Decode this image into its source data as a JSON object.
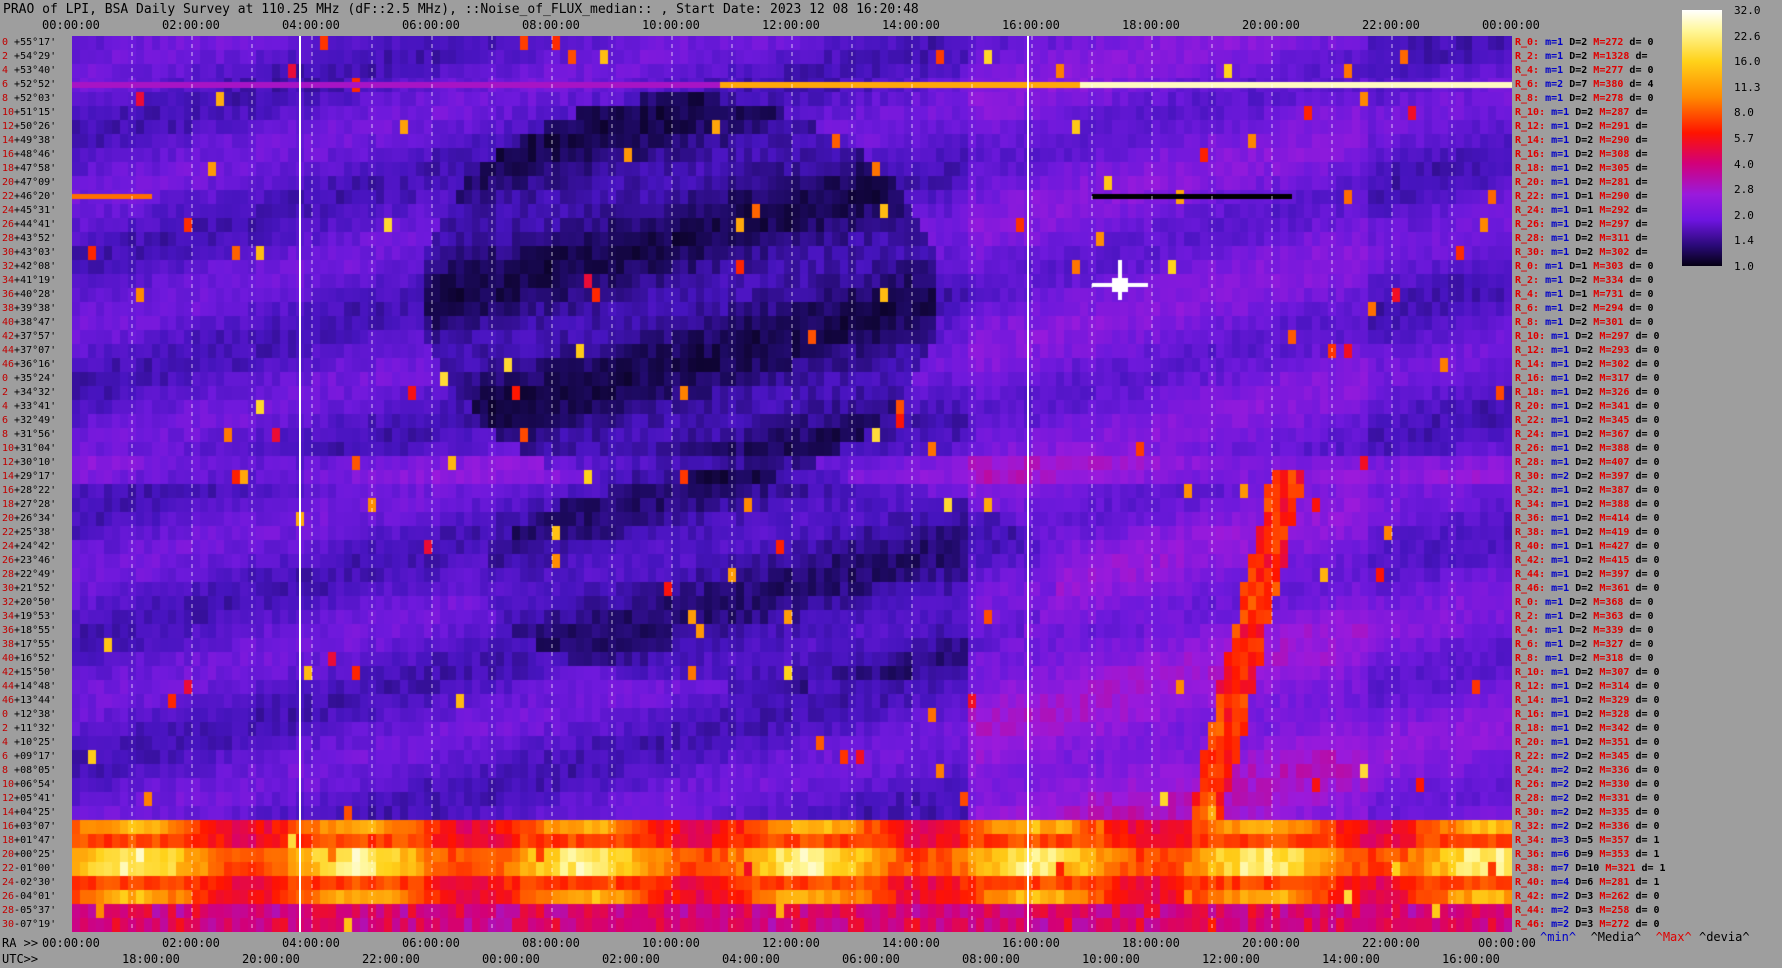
{
  "title": "PRAO of LPI, BSA Daily Survey at 110.25 MHz (dF::2.5 MHz), ::Noise_of_FLUX_median:: , Start Date: 2023 12 08 16:20:48",
  "top_axis_labels": [
    "00:00:00",
    "02:00:00",
    "04:00:00",
    "06:00:00",
    "08:00:00",
    "10:00:00",
    "12:00:00",
    "14:00:00",
    "16:00:00",
    "18:00:00",
    "20:00:00",
    "22:00:00",
    "00:00:00"
  ],
  "ra_axis": {
    "prefix": "RA >>",
    "labels": [
      "00:00:00",
      "02:00:00",
      "04:00:00",
      "06:00:00",
      "08:00:00",
      "10:00:00",
      "12:00:00",
      "14:00:00",
      "16:00:00",
      "18:00:00",
      "20:00:00",
      "22:00:00",
      "00:00:00"
    ]
  },
  "utc_axis": {
    "prefix": "UTC>>",
    "labels": [
      "18:00:00",
      "20:00:00",
      "22:00:00",
      "00:00:00",
      "02:00:00",
      "04:00:00",
      "06:00:00",
      "08:00:00",
      "10:00:00",
      "12:00:00",
      "14:00:00",
      "16:00:00"
    ]
  },
  "beams": [
    {
      "idx": "0",
      "dec": "+55°17'"
    },
    {
      "idx": "2",
      "dec": "+54°29'"
    },
    {
      "idx": "4",
      "dec": "+53°40'"
    },
    {
      "idx": "6",
      "dec": "+52°52'"
    },
    {
      "idx": "8",
      "dec": "+52°03'"
    },
    {
      "idx": "10",
      "dec": "+51°15'"
    },
    {
      "idx": "12",
      "dec": "+50°26'"
    },
    {
      "idx": "14",
      "dec": "+49°38'"
    },
    {
      "idx": "16",
      "dec": "+48°46'"
    },
    {
      "idx": "18",
      "dec": "+47°58'"
    },
    {
      "idx": "20",
      "dec": "+47°09'"
    },
    {
      "idx": "22",
      "dec": "+46°20'"
    },
    {
      "idx": "24",
      "dec": "+45°31'"
    },
    {
      "idx": "26",
      "dec": "+44°41'"
    },
    {
      "idx": "28",
      "dec": "+43°52'"
    },
    {
      "idx": "30",
      "dec": "+43°03'"
    },
    {
      "idx": "32",
      "dec": "+42°08'"
    },
    {
      "idx": "34",
      "dec": "+41°19'"
    },
    {
      "idx": "36",
      "dec": "+40°28'"
    },
    {
      "idx": "38",
      "dec": "+39°38'"
    },
    {
      "idx": "40",
      "dec": "+38°47'"
    },
    {
      "idx": "42",
      "dec": "+37°57'"
    },
    {
      "idx": "44",
      "dec": "+37°07'"
    },
    {
      "idx": "46",
      "dec": "+36°16'"
    },
    {
      "idx": "0",
      "dec": "+35°24'"
    },
    {
      "idx": "2",
      "dec": "+34°32'"
    },
    {
      "idx": "4",
      "dec": "+33°41'"
    },
    {
      "idx": "6",
      "dec": "+32°49'"
    },
    {
      "idx": "8",
      "dec": "+31°56'"
    },
    {
      "idx": "10",
      "dec": "+31°04'"
    },
    {
      "idx": "12",
      "dec": "+30°10'"
    },
    {
      "idx": "14",
      "dec": "+29°17'"
    },
    {
      "idx": "16",
      "dec": "+28°22'"
    },
    {
      "idx": "18",
      "dec": "+27°28'"
    },
    {
      "idx": "20",
      "dec": "+26°34'"
    },
    {
      "idx": "22",
      "dec": "+25°38'"
    },
    {
      "idx": "24",
      "dec": "+24°42'"
    },
    {
      "idx": "26",
      "dec": "+23°46'"
    },
    {
      "idx": "28",
      "dec": "+22°49'"
    },
    {
      "idx": "30",
      "dec": "+21°52'"
    },
    {
      "idx": "32",
      "dec": "+20°50'"
    },
    {
      "idx": "34",
      "dec": "+19°53'"
    },
    {
      "idx": "36",
      "dec": "+18°55'"
    },
    {
      "idx": "38",
      "dec": "+17°55'"
    },
    {
      "idx": "40",
      "dec": "+16°52'"
    },
    {
      "idx": "42",
      "dec": "+15°50'"
    },
    {
      "idx": "44",
      "dec": "+14°48'"
    },
    {
      "idx": "46",
      "dec": "+13°44'"
    },
    {
      "idx": "0",
      "dec": "+12°38'"
    },
    {
      "idx": "2",
      "dec": "+11°32'"
    },
    {
      "idx": "4",
      "dec": "+10°25'"
    },
    {
      "idx": "6",
      "dec": "+09°17'"
    },
    {
      "idx": "8",
      "dec": "+08°05'"
    },
    {
      "idx": "10",
      "dec": "+06°54'"
    },
    {
      "idx": "12",
      "dec": "+05°41'"
    },
    {
      "idx": "14",
      "dec": "+04°25'"
    },
    {
      "idx": "16",
      "dec": "+03°07'"
    },
    {
      "idx": "18",
      "dec": "+01°47'"
    },
    {
      "idx": "20",
      "dec": "+00°25'"
    },
    {
      "idx": "22",
      "dec": "-01°00'"
    },
    {
      "idx": "24",
      "dec": "-02°30'"
    },
    {
      "idx": "26",
      "dec": "-04°01'"
    },
    {
      "idx": "28",
      "dec": "-05°37'"
    },
    {
      "idx": "30",
      "dec": "-07°19'"
    }
  ],
  "stats": [
    {
      "r": "R_0:",
      "m": "m=1",
      "d": "D=2",
      "mx": "M=272",
      "dv": "d= 0"
    },
    {
      "r": "R_2:",
      "m": "m=1",
      "d": "D=2",
      "mx": "M=1328",
      "dv": "d="
    },
    {
      "r": "R_4:",
      "m": "m=1",
      "d": "D=2",
      "mx": "M=277",
      "dv": "d= 0"
    },
    {
      "r": "R_6:",
      "m": "m=2",
      "d": "D=7",
      "mx": "M=380",
      "dv": "d= 4"
    },
    {
      "r": "R_8:",
      "m": "m=1",
      "d": "D=2",
      "mx": "M=278",
      "dv": "d= 0"
    },
    {
      "r": "R_10:",
      "m": "m=1",
      "d": "D=2",
      "mx": "M=287",
      "dv": "d="
    },
    {
      "r": "R_12:",
      "m": "m=1",
      "d": "D=2",
      "mx": "M=291",
      "dv": "d="
    },
    {
      "r": "R_14:",
      "m": "m=1",
      "d": "D=2",
      "mx": "M=290",
      "dv": "d="
    },
    {
      "r": "R_16:",
      "m": "m=1",
      "d": "D=2",
      "mx": "M=308",
      "dv": "d="
    },
    {
      "r": "R_18:",
      "m": "m=1",
      "d": "D=2",
      "mx": "M=305",
      "dv": "d="
    },
    {
      "r": "R_20:",
      "m": "m=1",
      "d": "D=2",
      "mx": "M=281",
      "dv": "d="
    },
    {
      "r": "R_22:",
      "m": "m=1",
      "d": "D=1",
      "mx": "M=290",
      "dv": "d="
    },
    {
      "r": "R_24:",
      "m": "m=1",
      "d": "D=1",
      "mx": "M=292",
      "dv": "d="
    },
    {
      "r": "R_26:",
      "m": "m=1",
      "d": "D=2",
      "mx": "M=297",
      "dv": "d="
    },
    {
      "r": "R_28:",
      "m": "m=1",
      "d": "D=2",
      "mx": "M=311",
      "dv": "d="
    },
    {
      "r": "R_30:",
      "m": "m=1",
      "d": "D=2",
      "mx": "M=302",
      "dv": "d="
    },
    {
      "r": "R_0:",
      "m": "m=1",
      "d": "D=1",
      "mx": "M=303",
      "dv": "d= 0"
    },
    {
      "r": "R_2:",
      "m": "m=1",
      "d": "D=2",
      "mx": "M=334",
      "dv": "d= 0"
    },
    {
      "r": "R_4:",
      "m": "m=1",
      "d": "D=1",
      "mx": "M=731",
      "dv": "d= 0"
    },
    {
      "r": "R_6:",
      "m": "m=1",
      "d": "D=2",
      "mx": "M=294",
      "dv": "d= 0"
    },
    {
      "r": "R_8:",
      "m": "m=1",
      "d": "D=2",
      "mx": "M=301",
      "dv": "d= 0"
    },
    {
      "r": "R_10:",
      "m": "m=1",
      "d": "D=2",
      "mx": "M=297",
      "dv": "d= 0"
    },
    {
      "r": "R_12:",
      "m": "m=1",
      "d": "D=2",
      "mx": "M=293",
      "dv": "d= 0"
    },
    {
      "r": "R_14:",
      "m": "m=1",
      "d": "D=2",
      "mx": "M=302",
      "dv": "d= 0"
    },
    {
      "r": "R_16:",
      "m": "m=1",
      "d": "D=2",
      "mx": "M=317",
      "dv": "d= 0"
    },
    {
      "r": "R_18:",
      "m": "m=1",
      "d": "D=2",
      "mx": "M=326",
      "dv": "d= 0"
    },
    {
      "r": "R_20:",
      "m": "m=1",
      "d": "D=2",
      "mx": "M=341",
      "dv": "d= 0"
    },
    {
      "r": "R_22:",
      "m": "m=1",
      "d": "D=2",
      "mx": "M=345",
      "dv": "d= 0"
    },
    {
      "r": "R_24:",
      "m": "m=1",
      "d": "D=2",
      "mx": "M=367",
      "dv": "d= 0"
    },
    {
      "r": "R_26:",
      "m": "m=1",
      "d": "D=2",
      "mx": "M=388",
      "dv": "d= 0"
    },
    {
      "r": "R_28:",
      "m": "m=1",
      "d": "D=2",
      "mx": "M=407",
      "dv": "d= 0"
    },
    {
      "r": "R_30:",
      "m": "m=2",
      "d": "D=2",
      "mx": "M=397",
      "dv": "d= 0"
    },
    {
      "r": "R_32:",
      "m": "m=1",
      "d": "D=2",
      "mx": "M=387",
      "dv": "d= 0"
    },
    {
      "r": "R_34:",
      "m": "m=1",
      "d": "D=2",
      "mx": "M=388",
      "dv": "d= 0"
    },
    {
      "r": "R_36:",
      "m": "m=1",
      "d": "D=2",
      "mx": "M=414",
      "dv": "d= 0"
    },
    {
      "r": "R_38:",
      "m": "m=1",
      "d": "D=2",
      "mx": "M=419",
      "dv": "d= 0"
    },
    {
      "r": "R_40:",
      "m": "m=1",
      "d": "D=1",
      "mx": "M=427",
      "dv": "d= 0"
    },
    {
      "r": "R_42:",
      "m": "m=1",
      "d": "D=2",
      "mx": "M=415",
      "dv": "d= 0"
    },
    {
      "r": "R_44:",
      "m": "m=1",
      "d": "D=2",
      "mx": "M=397",
      "dv": "d= 0"
    },
    {
      "r": "R_46:",
      "m": "m=1",
      "d": "D=2",
      "mx": "M=361",
      "dv": "d= 0"
    },
    {
      "r": "R_0:",
      "m": "m=1",
      "d": "D=2",
      "mx": "M=368",
      "dv": "d= 0"
    },
    {
      "r": "R_2:",
      "m": "m=1",
      "d": "D=2",
      "mx": "M=363",
      "dv": "d= 0"
    },
    {
      "r": "R_4:",
      "m": "m=1",
      "d": "D=2",
      "mx": "M=339",
      "dv": "d= 0"
    },
    {
      "r": "R_6:",
      "m": "m=1",
      "d": "D=2",
      "mx": "M=327",
      "dv": "d= 0"
    },
    {
      "r": "R_8:",
      "m": "m=1",
      "d": "D=2",
      "mx": "M=318",
      "dv": "d= 0"
    },
    {
      "r": "R_10:",
      "m": "m=1",
      "d": "D=2",
      "mx": "M=307",
      "dv": "d= 0"
    },
    {
      "r": "R_12:",
      "m": "m=1",
      "d": "D=2",
      "mx": "M=314",
      "dv": "d= 0"
    },
    {
      "r": "R_14:",
      "m": "m=1",
      "d": "D=2",
      "mx": "M=329",
      "dv": "d= 0"
    },
    {
      "r": "R_16:",
      "m": "m=1",
      "d": "D=2",
      "mx": "M=328",
      "dv": "d= 0"
    },
    {
      "r": "R_18:",
      "m": "m=1",
      "d": "D=2",
      "mx": "M=342",
      "dv": "d= 0"
    },
    {
      "r": "R_20:",
      "m": "m=1",
      "d": "D=2",
      "mx": "M=351",
      "dv": "d= 0"
    },
    {
      "r": "R_22:",
      "m": "m=2",
      "d": "D=2",
      "mx": "M=345",
      "dv": "d= 0"
    },
    {
      "r": "R_24:",
      "m": "m=2",
      "d": "D=2",
      "mx": "M=336",
      "dv": "d= 0"
    },
    {
      "r": "R_26:",
      "m": "m=2",
      "d": "D=2",
      "mx": "M=330",
      "dv": "d= 0"
    },
    {
      "r": "R_28:",
      "m": "m=2",
      "d": "D=2",
      "mx": "M=331",
      "dv": "d= 0"
    },
    {
      "r": "R_30:",
      "m": "m=2",
      "d": "D=2",
      "mx": "M=335",
      "dv": "d= 0"
    },
    {
      "r": "R_32:",
      "m": "m=2",
      "d": "D=2",
      "mx": "M=336",
      "dv": "d= 0"
    },
    {
      "r": "R_34:",
      "m": "m=3",
      "d": "D=5",
      "mx": "M=357",
      "dv": "d= 1"
    },
    {
      "r": "R_36:",
      "m": "m=6",
      "d": "D=9",
      "mx": "M=353",
      "dv": "d= 1"
    },
    {
      "r": "R_38:",
      "m": "m=7",
      "d": "D=10",
      "mx": "M=321",
      "dv": "d= 1"
    },
    {
      "r": "R_40:",
      "m": "m=4",
      "d": "D=6",
      "mx": "M=281",
      "dv": "d= 1"
    },
    {
      "r": "R_42:",
      "m": "m=2",
      "d": "D=3",
      "mx": "M=262",
      "dv": "d= 0"
    },
    {
      "r": "R_44:",
      "m": "m=2",
      "d": "D=3",
      "mx": "M=258",
      "dv": "d= 0"
    },
    {
      "r": "R_46:",
      "m": "m=2",
      "d": "D=3",
      "mx": "M=272",
      "dv": "d= 0"
    }
  ],
  "colorbar": {
    "ticks": [
      "32.0",
      "22.6",
      "16.0",
      "11.3",
      "8.0",
      "5.7",
      "4.0",
      "2.8",
      "2.0",
      "1.4",
      "1.0"
    ]
  },
  "footer": {
    "min": "^min^",
    "median": "^Media^",
    "max": "^Max^",
    "devia": "^devia^"
  },
  "chart_data": {
    "type": "heatmap",
    "title": "PRAO of LPI, BSA Daily Survey at 110.25 MHz (dF::2.5 MHz), ::Noise_of_FLUX_median:: , Start Date: 2023 12 08 16:20:48",
    "x_axis": {
      "quantity": "RA / UTC",
      "range": [
        "00:00:00",
        "24:00:00"
      ]
    },
    "y_axis": {
      "quantity": "declination",
      "range": [
        "+55°17'",
        "-07°19'"
      ],
      "rows": 64
    },
    "color_scale": {
      "min": 1.0,
      "max": 32.0,
      "scale": "log2",
      "ticks": [
        32.0,
        22.6,
        16.0,
        11.3,
        8.0,
        5.7,
        4.0,
        2.8,
        2.0,
        1.4,
        1.0
      ]
    },
    "features": [
      {
        "kind": "horizontal-band",
        "beam_dec": "+52°52'",
        "level": "high"
      },
      {
        "kind": "horizontal-band",
        "beam_dec": "-01°00'",
        "level": "high"
      },
      {
        "kind": "point-source",
        "ra": "20:00:00",
        "dec": "+40°28'",
        "level": "saturated"
      }
    ]
  }
}
